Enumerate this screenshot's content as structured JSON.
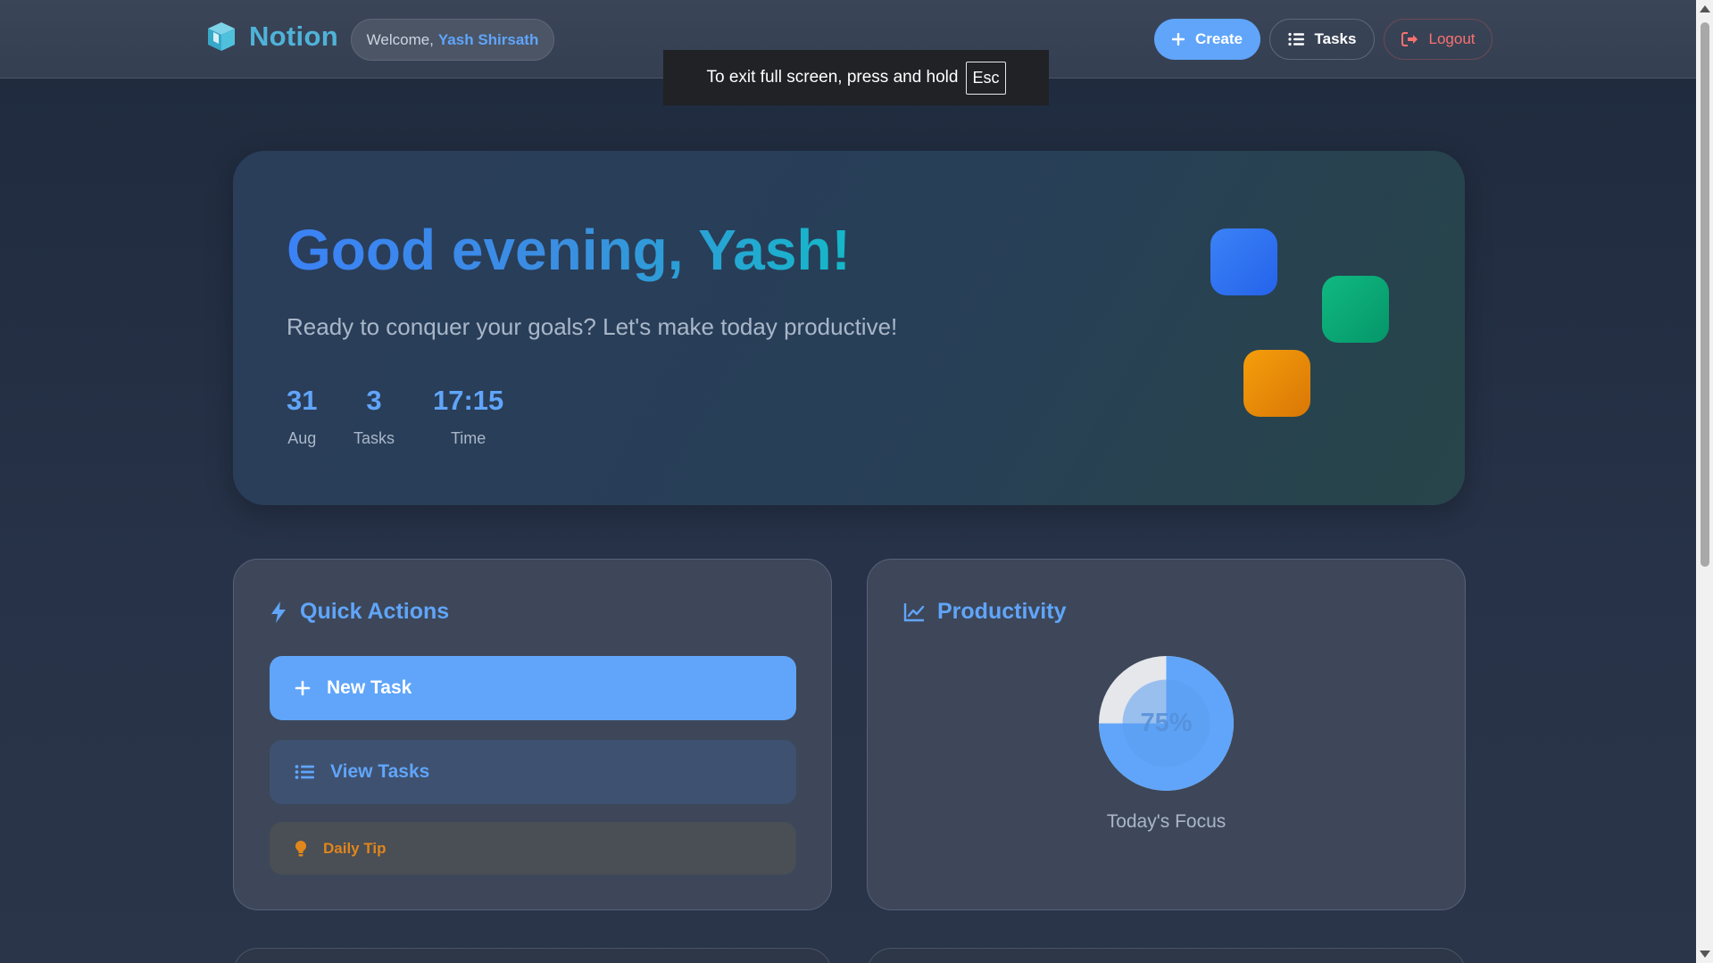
{
  "nav": {
    "brand": "Notion",
    "welcome_prefix": "Welcome,",
    "welcome_name": "Yash Shirsath",
    "create_label": "Create",
    "tasks_label": "Tasks",
    "logout_label": "Logout"
  },
  "toast": {
    "message": "To exit full screen, press and hold",
    "key": "Esc"
  },
  "hero": {
    "greeting": "Good evening, Yash!",
    "subtitle": "Ready to conquer your goals? Let's make today productive!",
    "stats": [
      {
        "value": "31",
        "label": "Aug"
      },
      {
        "value": "3",
        "label": "Tasks"
      },
      {
        "value": "17:15",
        "label": "Time"
      }
    ]
  },
  "quick_actions": {
    "title": "Quick Actions",
    "new_task": "New Task",
    "view_tasks": "View Tasks",
    "daily_tip": "Daily Tip"
  },
  "productivity": {
    "title": "Productivity",
    "percent": 75,
    "percent_label": "75%",
    "caption": "Today's Focus"
  },
  "colors": {
    "accent": "#60a5fa",
    "logout": "#f87171",
    "tip": "#e0861b"
  }
}
